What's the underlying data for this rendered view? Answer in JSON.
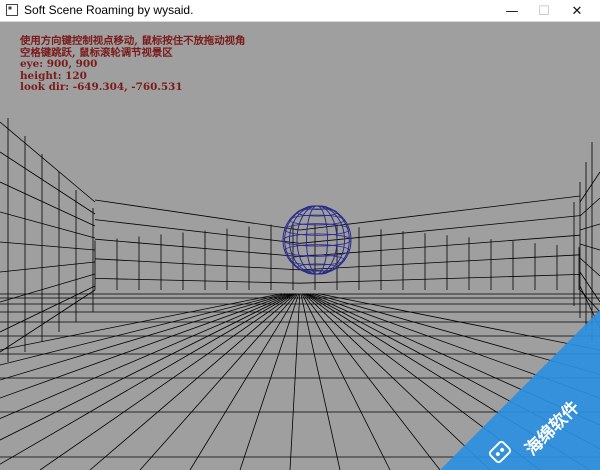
{
  "window": {
    "title": "Soft Scene Roaming by wysaid.",
    "icons": {
      "app": "app-icon",
      "minimize": "minimize-icon",
      "maximize": "maximize-icon",
      "close": "close-icon"
    }
  },
  "hud": {
    "line1": "使用方向键控制视点移动, 鼠标按住不放拖动视角",
    "line2": "空格键跳跃, 鼠标滚轮调节视景区",
    "line3": "eye: 900, 900",
    "line4": "height: 120",
    "line5": "look dir: -649.304, -760.531"
  },
  "watermark": {
    "text": "海绵软件",
    "icon": "sponge-logo-icon"
  },
  "colors": {
    "scene_bg": "#9f9f9f",
    "grid_line": "#000000",
    "sphere_line": "#2a2a8a",
    "hud_text": "#7b1a1a",
    "watermark": "#2b8fe0"
  }
}
